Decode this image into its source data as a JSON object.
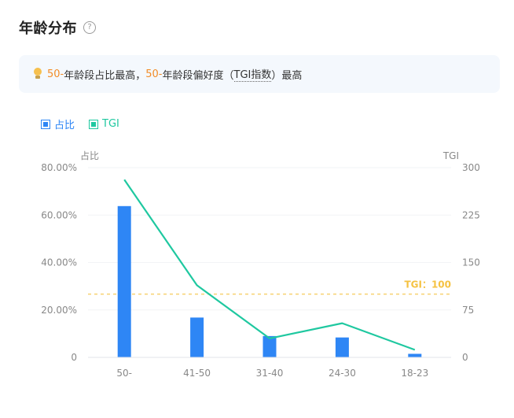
{
  "header": {
    "title": "年龄分布",
    "help_icon": "?"
  },
  "insight": {
    "bulb_icon": "lightbulb-icon",
    "part1_hl": "50-",
    "part1": "年龄段占比最高，",
    "part2_hl": "50-",
    "part2a": "年龄段偏好度（",
    "part2_term": "TGI指数",
    "part2b": "）最高"
  },
  "legend": [
    {
      "label": "占比",
      "color": "#2e86f5"
    },
    {
      "label": "TGI",
      "color": "#1fc8a0"
    }
  ],
  "chart_data": {
    "type": "bar",
    "categories": [
      "50-",
      "41-50",
      "31-40",
      "24-30",
      "18-23"
    ],
    "series": [
      {
        "name": "占比",
        "type": "bar",
        "axis": "left",
        "color": "#2e86f5",
        "values": [
          63.8,
          16.8,
          9.0,
          8.4,
          1.5
        ]
      },
      {
        "name": "TGI",
        "type": "line",
        "axis": "right",
        "color": "#1fc8a0",
        "values": [
          281,
          114,
          30,
          54,
          12
        ]
      }
    ],
    "y_left": {
      "title": "占比",
      "ylim": [
        0,
        80
      ],
      "ticks": [
        "0",
        "20.00%",
        "40.00%",
        "60.00%",
        "80.00%"
      ],
      "tick_values": [
        0,
        20,
        40,
        60,
        80
      ]
    },
    "y_right": {
      "title": "TGI",
      "ylim": [
        0,
        300
      ],
      "ticks": [
        "0",
        "75",
        "150",
        "225",
        "300"
      ],
      "tick_values": [
        0,
        75,
        150,
        225,
        300
      ]
    },
    "reference_line": {
      "axis": "right",
      "value": 100,
      "label": "TGI：100",
      "color": "#f5c242"
    },
    "grid": true,
    "legend_position": "top-left"
  }
}
